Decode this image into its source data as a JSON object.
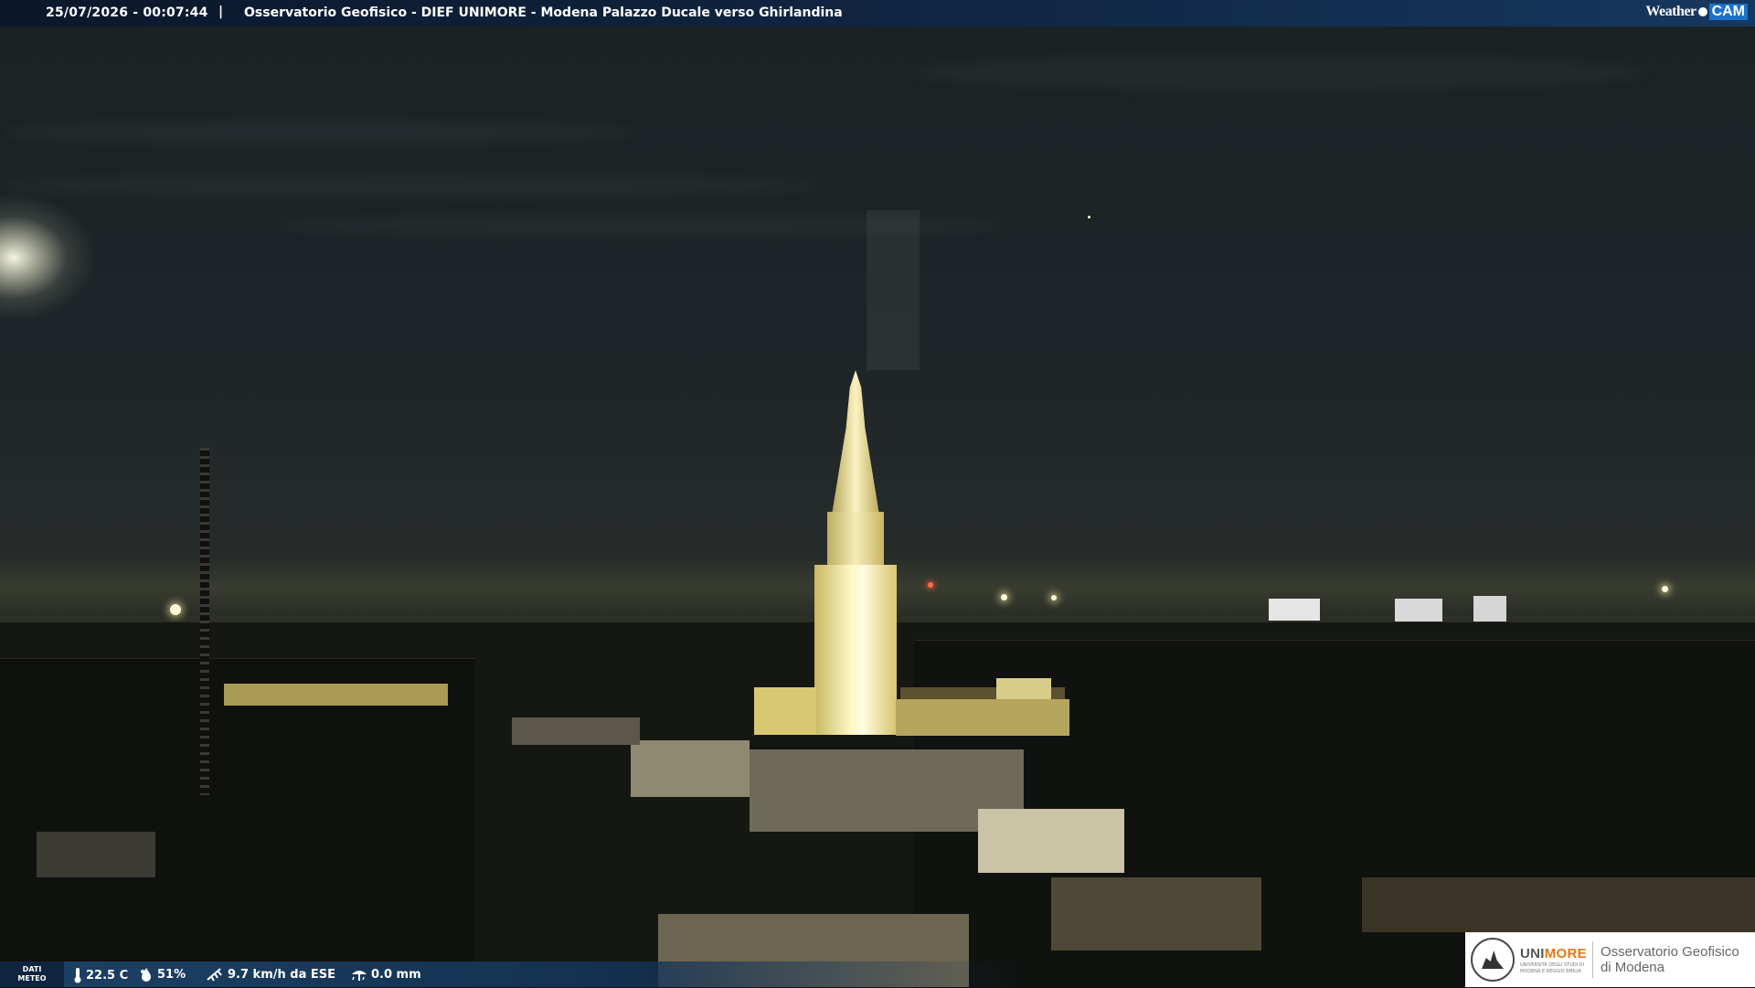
{
  "header": {
    "timestamp": "25/07/2026 - 00:07:44",
    "separator": "|",
    "title": "Osservatorio Geofisico - DIEF UNIMORE - Modena Palazzo Ducale verso Ghirlandina"
  },
  "logo": {
    "weather": "Weather",
    "cam": "CAM"
  },
  "weather_bar": {
    "dati_line1": "DATI",
    "dati_line2": "METEO",
    "temperature": "22.5 C",
    "humidity": "51%",
    "wind": "9.7 km/h da ESE",
    "rain": "0.0 mm"
  },
  "institution": {
    "brand_part1": "UNI",
    "brand_part2": "MORE",
    "brand_sub_line1": "UNIVERSITÀ DEGLI STUDI DI",
    "brand_sub_line2": "MODENA E REGGIO EMILIA",
    "observatory_line1": "Osservatorio Geofisico",
    "observatory_line2": "di Modena"
  },
  "icons": {
    "temperature": "thermometer-icon",
    "humidity": "droplet-icon",
    "wind": "wind-icon",
    "rain": "rain-gauge-icon"
  }
}
